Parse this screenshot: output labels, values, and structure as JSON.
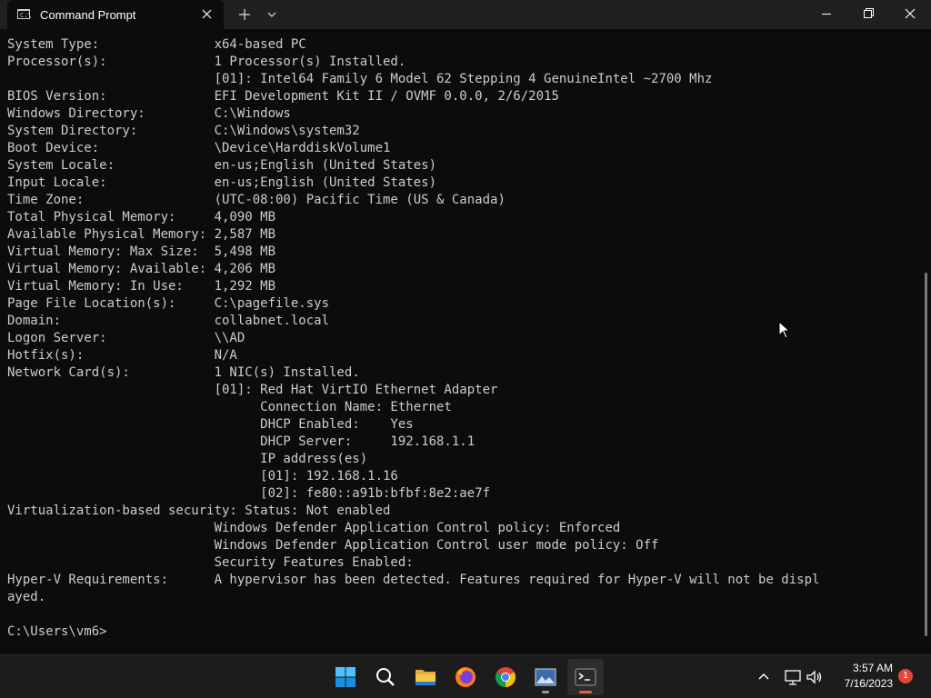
{
  "window": {
    "tab_title": "Command Prompt",
    "tab_icon_glyph": "C:\\",
    "icons": {
      "tab_close": "close-icon",
      "new_tab": "plus-icon",
      "dropdown": "chevron-down-icon",
      "minimize": "minimize-icon",
      "maximize": "restore-icon",
      "close": "close-icon"
    }
  },
  "console": {
    "output": "System Type:               x64-based PC\nProcessor(s):              1 Processor(s) Installed.\n                           [01]: Intel64 Family 6 Model 62 Stepping 4 GenuineIntel ~2700 Mhz\nBIOS Version:              EFI Development Kit II / OVMF 0.0.0, 2/6/2015\nWindows Directory:         C:\\Windows\nSystem Directory:          C:\\Windows\\system32\nBoot Device:               \\Device\\HarddiskVolume1\nSystem Locale:             en-us;English (United States)\nInput Locale:              en-us;English (United States)\nTime Zone:                 (UTC-08:00) Pacific Time (US & Canada)\nTotal Physical Memory:     4,090 MB\nAvailable Physical Memory: 2,587 MB\nVirtual Memory: Max Size:  5,498 MB\nVirtual Memory: Available: 4,206 MB\nVirtual Memory: In Use:    1,292 MB\nPage File Location(s):     C:\\pagefile.sys\nDomain:                    collabnet.local\nLogon Server:              \\\\AD\nHotfix(s):                 N/A\nNetwork Card(s):           1 NIC(s) Installed.\n                           [01]: Red Hat VirtIO Ethernet Adapter\n                                 Connection Name: Ethernet\n                                 DHCP Enabled:    Yes\n                                 DHCP Server:     192.168.1.1\n                                 IP address(es)\n                                 [01]: 192.168.1.16\n                                 [02]: fe80::a91b:bfbf:8e2:ae7f\nVirtualization-based security: Status: Not enabled\n                           Windows Defender Application Control policy: Enforced\n                           Windows Defender Application Control user mode policy: Off\n                           Security Features Enabled:\nHyper-V Requirements:      A hypervisor has been detected. Features required for Hyper-V will not be displ\nayed.\n\nC:\\Users\\vm6>"
  },
  "taskbar": {
    "items": [
      {
        "name": "start-button",
        "icon": "windows-logo-icon"
      },
      {
        "name": "search-button",
        "icon": "search-icon"
      },
      {
        "name": "file-explorer-button",
        "icon": "folder-icon"
      },
      {
        "name": "firefox-button",
        "icon": "firefox-icon"
      },
      {
        "name": "chrome-button",
        "icon": "chrome-icon"
      },
      {
        "name": "photos-button",
        "icon": "photos-icon"
      },
      {
        "name": "terminal-button",
        "icon": "terminal-icon"
      }
    ],
    "tray": {
      "chevron_icon": "chevron-up-icon",
      "network_icon": "network-icon",
      "volume_icon": "volume-icon",
      "time": "3:57 AM",
      "date": "7/16/2023",
      "notification_count": "1"
    }
  },
  "colors": {
    "console_bg": "#0c0c0c",
    "console_text": "#cccccc",
    "titlebar_bg": "#202020",
    "taskbar_bg": "#1c1c1c",
    "accent": "#e85c4a",
    "badge": "#e2463a"
  }
}
